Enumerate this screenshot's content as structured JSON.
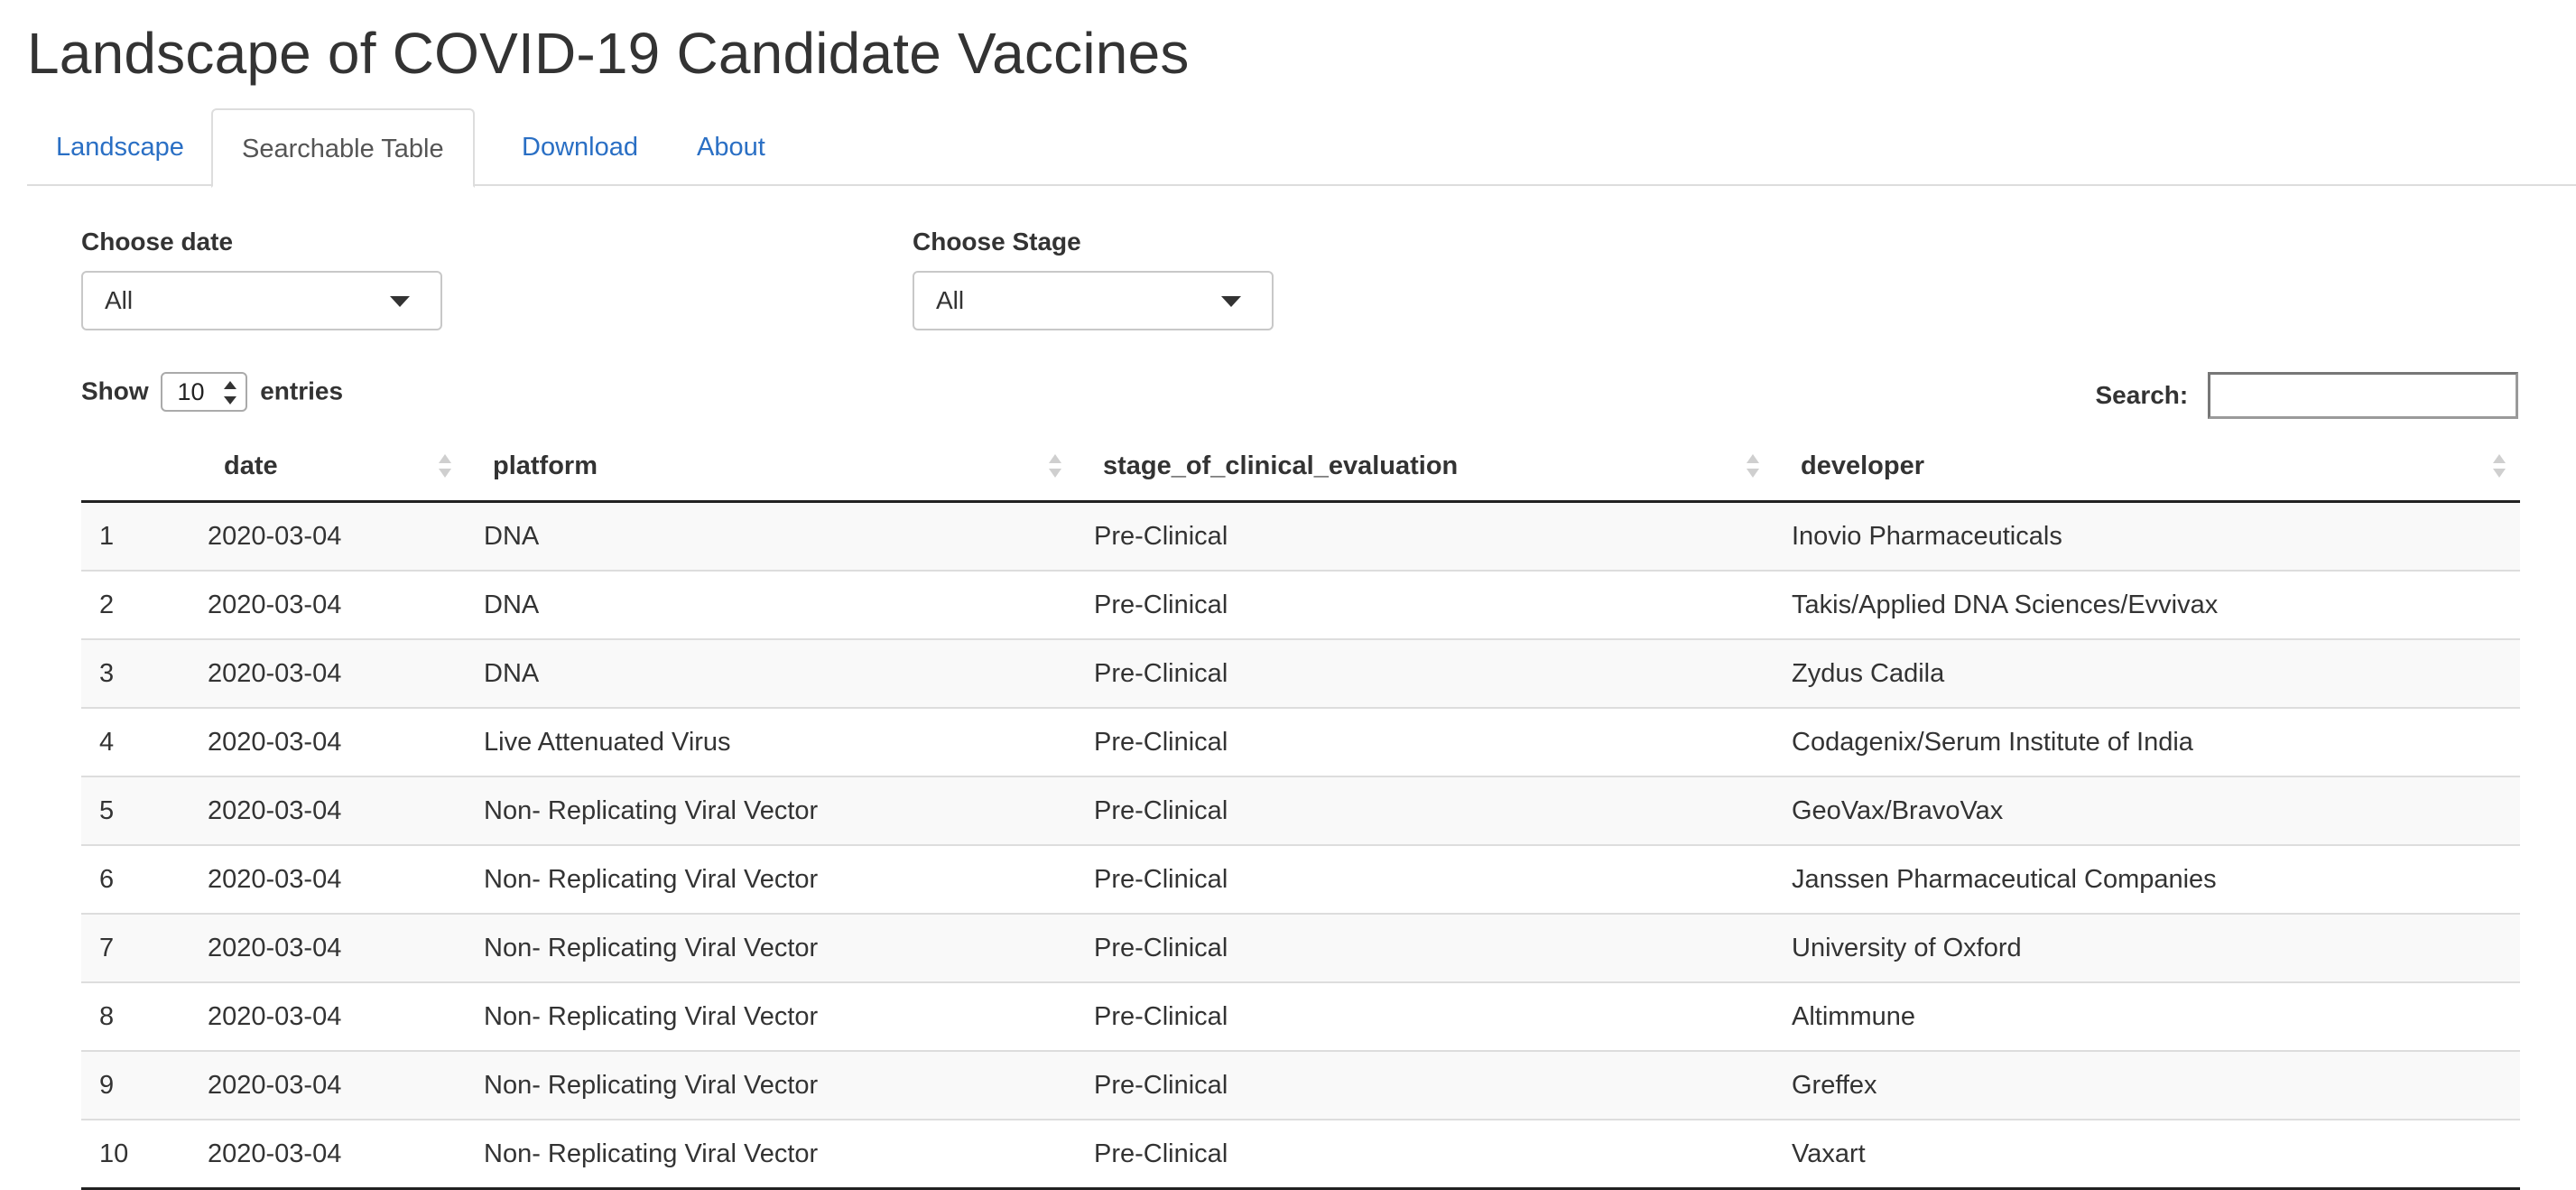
{
  "app": {
    "title": "Landscape of COVID-19 Candidate Vaccines"
  },
  "tabs": [
    {
      "label": "Landscape",
      "active": false
    },
    {
      "label": "Searchable Table",
      "active": true
    },
    {
      "label": "Download",
      "active": false
    },
    {
      "label": "About",
      "active": false
    }
  ],
  "filters": {
    "date": {
      "label": "Choose date",
      "value": "All"
    },
    "stage": {
      "label": "Choose Stage",
      "value": "All"
    }
  },
  "length": {
    "prefix": "Show",
    "value": "10",
    "suffix": "entries"
  },
  "search": {
    "label": "Search:",
    "value": ""
  },
  "table": {
    "columns": [
      "date",
      "platform",
      "stage_of_clinical_evaluation",
      "developer"
    ],
    "rows": [
      [
        "1",
        "2020-03-04",
        "DNA",
        "Pre-Clinical",
        "Inovio Pharmaceuticals"
      ],
      [
        "2",
        "2020-03-04",
        "DNA",
        "Pre-Clinical",
        "Takis/Applied DNA Sciences/Evvivax"
      ],
      [
        "3",
        "2020-03-04",
        "DNA",
        "Pre-Clinical",
        "Zydus Cadila"
      ],
      [
        "4",
        "2020-03-04",
        "Live Attenuated Virus",
        "Pre-Clinical",
        "Codagenix/Serum Institute of India"
      ],
      [
        "5",
        "2020-03-04",
        "Non- Replicating Viral Vector",
        "Pre-Clinical",
        "GeoVax/BravoVax"
      ],
      [
        "6",
        "2020-03-04",
        "Non- Replicating Viral Vector",
        "Pre-Clinical",
        "Janssen Pharmaceutical Companies"
      ],
      [
        "7",
        "2020-03-04",
        "Non- Replicating Viral Vector",
        "Pre-Clinical",
        "University of Oxford"
      ],
      [
        "8",
        "2020-03-04",
        "Non- Replicating Viral Vector",
        "Pre-Clinical",
        "Altimmune"
      ],
      [
        "9",
        "2020-03-04",
        "Non- Replicating Viral Vector",
        "Pre-Clinical",
        "Greffex"
      ],
      [
        "10",
        "2020-03-04",
        "Non- Replicating Viral Vector",
        "Pre-Clinical",
        "Vaxart"
      ]
    ]
  },
  "colors": {
    "link": "#2a6fc4",
    "border": "#dddddd",
    "stripe": "#f9f9f9"
  }
}
